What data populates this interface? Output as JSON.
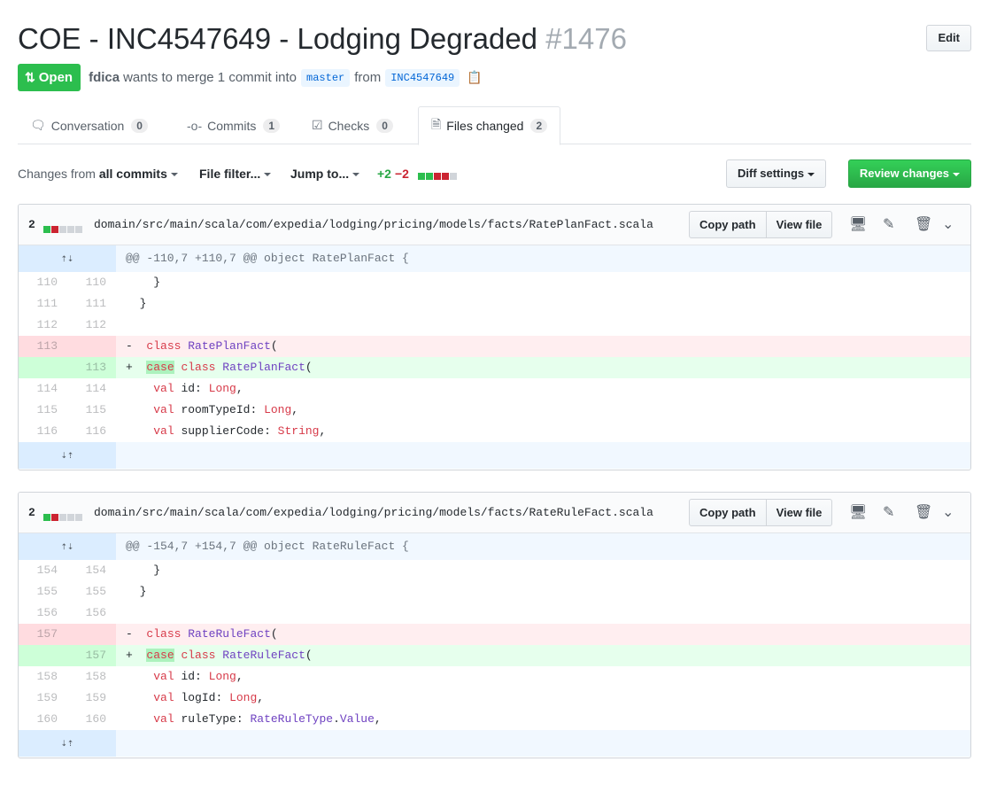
{
  "header": {
    "title": "COE - INC4547649 - Lodging Degraded",
    "number": "#1476",
    "edit_label": "Edit"
  },
  "meta": {
    "state_label": "Open",
    "author": "fdica",
    "text_merge": "wants to merge 1 commit into",
    "base_branch": "master",
    "text_from": "from",
    "head_branch": "INC4547649"
  },
  "tabs": [
    {
      "label": "Conversation",
      "count": "0"
    },
    {
      "label": "Commits",
      "count": "1"
    },
    {
      "label": "Checks",
      "count": "0"
    },
    {
      "label": "Files changed",
      "count": "2"
    }
  ],
  "toolbar": {
    "changes_prefix": "Changes from",
    "changes_value": "all commits",
    "file_filter": "File filter...",
    "jump_to": "Jump to...",
    "additions": "+2",
    "deletions": "−2",
    "diff_settings": "Diff settings",
    "review_changes": "Review changes"
  },
  "files": [
    {
      "count": "2",
      "path": "domain/src/main/scala/com/expedia/lodging/pricing/models/facts/RatePlanFact.scala",
      "copy_path": "Copy path",
      "view_file": "View file",
      "hunk": "@@ -110,7 +110,7 @@ object RatePlanFact {",
      "lines": [
        {
          "old": "110",
          "new": "110",
          "code": "    }"
        },
        {
          "old": "111",
          "new": "111",
          "code": "  }"
        },
        {
          "old": "112",
          "new": "112",
          "code": ""
        },
        {
          "old": "113",
          "new": "",
          "sign": "-",
          "kw": "class",
          "name": "RatePlanFact",
          "tail": "("
        },
        {
          "old": "",
          "new": "113",
          "sign": "+",
          "kw0": "case",
          "kw": "class",
          "name": "RatePlanFact",
          "tail": "("
        },
        {
          "old": "114",
          "new": "114",
          "field": "id",
          "type": "Long",
          "tail": ","
        },
        {
          "old": "115",
          "new": "115",
          "field": "roomTypeId",
          "type": "Long",
          "tail": ","
        },
        {
          "old": "116",
          "new": "116",
          "field": "supplierCode",
          "type": "String",
          "tail": ","
        }
      ]
    },
    {
      "count": "2",
      "path": "domain/src/main/scala/com/expedia/lodging/pricing/models/facts/RateRuleFact.scala",
      "copy_path": "Copy path",
      "view_file": "View file",
      "hunk": "@@ -154,7 +154,7 @@ object RateRuleFact {",
      "lines": [
        {
          "old": "154",
          "new": "154",
          "code": "    }"
        },
        {
          "old": "155",
          "new": "155",
          "code": "  }"
        },
        {
          "old": "156",
          "new": "156",
          "code": ""
        },
        {
          "old": "157",
          "new": "",
          "sign": "-",
          "kw": "class",
          "name": "RateRuleFact",
          "tail": "("
        },
        {
          "old": "",
          "new": "157",
          "sign": "+",
          "kw0": "case",
          "kw": "class",
          "name": "RateRuleFact",
          "tail": "("
        },
        {
          "old": "158",
          "new": "158",
          "field": "id",
          "type": "Long",
          "tail": ","
        },
        {
          "old": "159",
          "new": "159",
          "field": "logId",
          "type": "Long",
          "tail": ","
        },
        {
          "old": "160",
          "new": "160",
          "field": "ruleType",
          "type": "RateRuleType",
          "type2": "Value",
          "tail": ","
        }
      ]
    }
  ],
  "colors": {
    "open_badge": "#2cbe4e",
    "review_button": "#28a745",
    "addition": "#e6ffed",
    "deletion": "#ffeef0",
    "hunk": "#f1f8ff"
  }
}
